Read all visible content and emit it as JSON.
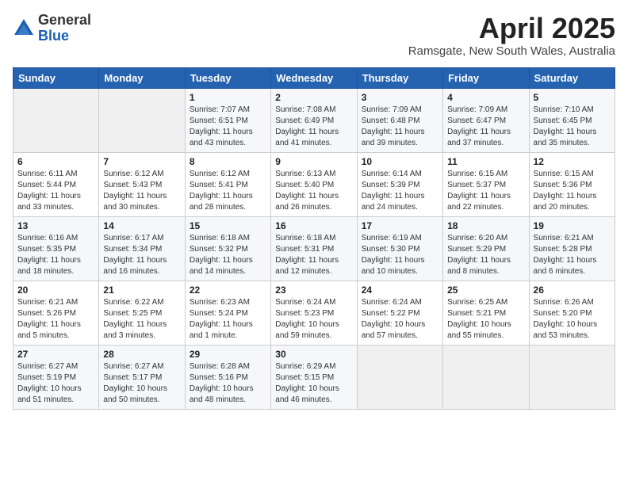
{
  "logo": {
    "general": "General",
    "blue": "Blue"
  },
  "title": "April 2025",
  "location": "Ramsgate, New South Wales, Australia",
  "days_header": [
    "Sunday",
    "Monday",
    "Tuesday",
    "Wednesday",
    "Thursday",
    "Friday",
    "Saturday"
  ],
  "weeks": [
    [
      {
        "day": "",
        "info": ""
      },
      {
        "day": "",
        "info": ""
      },
      {
        "day": "1",
        "info": "Sunrise: 7:07 AM\nSunset: 6:51 PM\nDaylight: 11 hours and 43 minutes."
      },
      {
        "day": "2",
        "info": "Sunrise: 7:08 AM\nSunset: 6:49 PM\nDaylight: 11 hours and 41 minutes."
      },
      {
        "day": "3",
        "info": "Sunrise: 7:09 AM\nSunset: 6:48 PM\nDaylight: 11 hours and 39 minutes."
      },
      {
        "day": "4",
        "info": "Sunrise: 7:09 AM\nSunset: 6:47 PM\nDaylight: 11 hours and 37 minutes."
      },
      {
        "day": "5",
        "info": "Sunrise: 7:10 AM\nSunset: 6:45 PM\nDaylight: 11 hours and 35 minutes."
      }
    ],
    [
      {
        "day": "6",
        "info": "Sunrise: 6:11 AM\nSunset: 5:44 PM\nDaylight: 11 hours and 33 minutes."
      },
      {
        "day": "7",
        "info": "Sunrise: 6:12 AM\nSunset: 5:43 PM\nDaylight: 11 hours and 30 minutes."
      },
      {
        "day": "8",
        "info": "Sunrise: 6:12 AM\nSunset: 5:41 PM\nDaylight: 11 hours and 28 minutes."
      },
      {
        "day": "9",
        "info": "Sunrise: 6:13 AM\nSunset: 5:40 PM\nDaylight: 11 hours and 26 minutes."
      },
      {
        "day": "10",
        "info": "Sunrise: 6:14 AM\nSunset: 5:39 PM\nDaylight: 11 hours and 24 minutes."
      },
      {
        "day": "11",
        "info": "Sunrise: 6:15 AM\nSunset: 5:37 PM\nDaylight: 11 hours and 22 minutes."
      },
      {
        "day": "12",
        "info": "Sunrise: 6:15 AM\nSunset: 5:36 PM\nDaylight: 11 hours and 20 minutes."
      }
    ],
    [
      {
        "day": "13",
        "info": "Sunrise: 6:16 AM\nSunset: 5:35 PM\nDaylight: 11 hours and 18 minutes."
      },
      {
        "day": "14",
        "info": "Sunrise: 6:17 AM\nSunset: 5:34 PM\nDaylight: 11 hours and 16 minutes."
      },
      {
        "day": "15",
        "info": "Sunrise: 6:18 AM\nSunset: 5:32 PM\nDaylight: 11 hours and 14 minutes."
      },
      {
        "day": "16",
        "info": "Sunrise: 6:18 AM\nSunset: 5:31 PM\nDaylight: 11 hours and 12 minutes."
      },
      {
        "day": "17",
        "info": "Sunrise: 6:19 AM\nSunset: 5:30 PM\nDaylight: 11 hours and 10 minutes."
      },
      {
        "day": "18",
        "info": "Sunrise: 6:20 AM\nSunset: 5:29 PM\nDaylight: 11 hours and 8 minutes."
      },
      {
        "day": "19",
        "info": "Sunrise: 6:21 AM\nSunset: 5:28 PM\nDaylight: 11 hours and 6 minutes."
      }
    ],
    [
      {
        "day": "20",
        "info": "Sunrise: 6:21 AM\nSunset: 5:26 PM\nDaylight: 11 hours and 5 minutes."
      },
      {
        "day": "21",
        "info": "Sunrise: 6:22 AM\nSunset: 5:25 PM\nDaylight: 11 hours and 3 minutes."
      },
      {
        "day": "22",
        "info": "Sunrise: 6:23 AM\nSunset: 5:24 PM\nDaylight: 11 hours and 1 minute."
      },
      {
        "day": "23",
        "info": "Sunrise: 6:24 AM\nSunset: 5:23 PM\nDaylight: 10 hours and 59 minutes."
      },
      {
        "day": "24",
        "info": "Sunrise: 6:24 AM\nSunset: 5:22 PM\nDaylight: 10 hours and 57 minutes."
      },
      {
        "day": "25",
        "info": "Sunrise: 6:25 AM\nSunset: 5:21 PM\nDaylight: 10 hours and 55 minutes."
      },
      {
        "day": "26",
        "info": "Sunrise: 6:26 AM\nSunset: 5:20 PM\nDaylight: 10 hours and 53 minutes."
      }
    ],
    [
      {
        "day": "27",
        "info": "Sunrise: 6:27 AM\nSunset: 5:19 PM\nDaylight: 10 hours and 51 minutes."
      },
      {
        "day": "28",
        "info": "Sunrise: 6:27 AM\nSunset: 5:17 PM\nDaylight: 10 hours and 50 minutes."
      },
      {
        "day": "29",
        "info": "Sunrise: 6:28 AM\nSunset: 5:16 PM\nDaylight: 10 hours and 48 minutes."
      },
      {
        "day": "30",
        "info": "Sunrise: 6:29 AM\nSunset: 5:15 PM\nDaylight: 10 hours and 46 minutes."
      },
      {
        "day": "",
        "info": ""
      },
      {
        "day": "",
        "info": ""
      },
      {
        "day": "",
        "info": ""
      }
    ]
  ]
}
